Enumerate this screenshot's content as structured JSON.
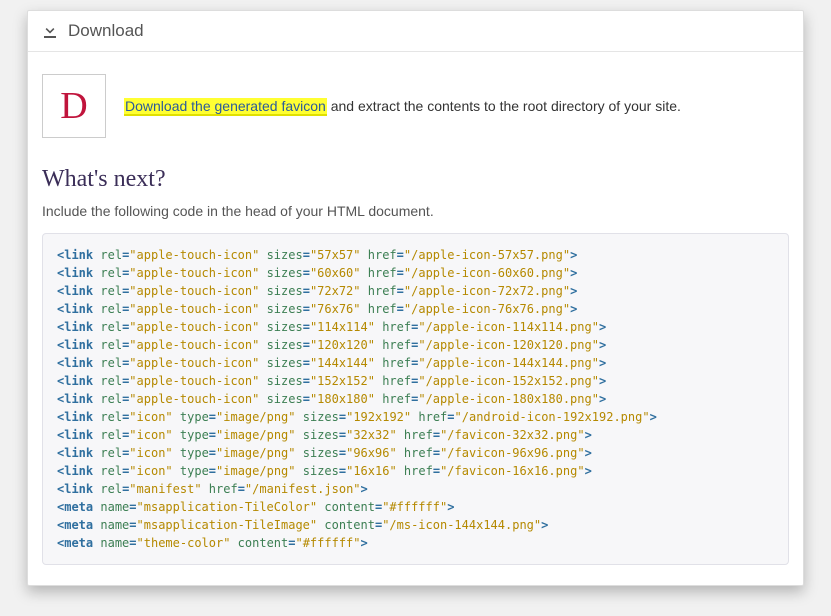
{
  "header": {
    "title": "Download"
  },
  "favicon_letter": "D",
  "instruction": {
    "link_text": "Download the generated favicon",
    "rest_text": " and extract the contents to the root directory of your site."
  },
  "next_heading": "What's next?",
  "next_sub": "Include the following code in the head of your HTML document.",
  "code_lines": [
    {
      "tag": "link",
      "attrs": [
        [
          "rel",
          "apple-touch-icon"
        ],
        [
          "sizes",
          "57x57"
        ],
        [
          "href",
          "/apple-icon-57x57.png"
        ]
      ]
    },
    {
      "tag": "link",
      "attrs": [
        [
          "rel",
          "apple-touch-icon"
        ],
        [
          "sizes",
          "60x60"
        ],
        [
          "href",
          "/apple-icon-60x60.png"
        ]
      ]
    },
    {
      "tag": "link",
      "attrs": [
        [
          "rel",
          "apple-touch-icon"
        ],
        [
          "sizes",
          "72x72"
        ],
        [
          "href",
          "/apple-icon-72x72.png"
        ]
      ]
    },
    {
      "tag": "link",
      "attrs": [
        [
          "rel",
          "apple-touch-icon"
        ],
        [
          "sizes",
          "76x76"
        ],
        [
          "href",
          "/apple-icon-76x76.png"
        ]
      ]
    },
    {
      "tag": "link",
      "attrs": [
        [
          "rel",
          "apple-touch-icon"
        ],
        [
          "sizes",
          "114x114"
        ],
        [
          "href",
          "/apple-icon-114x114.png"
        ]
      ]
    },
    {
      "tag": "link",
      "attrs": [
        [
          "rel",
          "apple-touch-icon"
        ],
        [
          "sizes",
          "120x120"
        ],
        [
          "href",
          "/apple-icon-120x120.png"
        ]
      ]
    },
    {
      "tag": "link",
      "attrs": [
        [
          "rel",
          "apple-touch-icon"
        ],
        [
          "sizes",
          "144x144"
        ],
        [
          "href",
          "/apple-icon-144x144.png"
        ]
      ]
    },
    {
      "tag": "link",
      "attrs": [
        [
          "rel",
          "apple-touch-icon"
        ],
        [
          "sizes",
          "152x152"
        ],
        [
          "href",
          "/apple-icon-152x152.png"
        ]
      ]
    },
    {
      "tag": "link",
      "attrs": [
        [
          "rel",
          "apple-touch-icon"
        ],
        [
          "sizes",
          "180x180"
        ],
        [
          "href",
          "/apple-icon-180x180.png"
        ]
      ]
    },
    {
      "tag": "link",
      "attrs": [
        [
          "rel",
          "icon"
        ],
        [
          "type",
          "image/png"
        ],
        [
          "sizes",
          "192x192"
        ],
        [
          "href",
          "/android-icon-192x192.png"
        ]
      ]
    },
    {
      "tag": "link",
      "attrs": [
        [
          "rel",
          "icon"
        ],
        [
          "type",
          "image/png"
        ],
        [
          "sizes",
          "32x32"
        ],
        [
          "href",
          "/favicon-32x32.png"
        ]
      ]
    },
    {
      "tag": "link",
      "attrs": [
        [
          "rel",
          "icon"
        ],
        [
          "type",
          "image/png"
        ],
        [
          "sizes",
          "96x96"
        ],
        [
          "href",
          "/favicon-96x96.png"
        ]
      ]
    },
    {
      "tag": "link",
      "attrs": [
        [
          "rel",
          "icon"
        ],
        [
          "type",
          "image/png"
        ],
        [
          "sizes",
          "16x16"
        ],
        [
          "href",
          "/favicon-16x16.png"
        ]
      ]
    },
    {
      "tag": "link",
      "attrs": [
        [
          "rel",
          "manifest"
        ],
        [
          "href",
          "/manifest.json"
        ]
      ]
    },
    {
      "tag": "meta",
      "attrs": [
        [
          "name",
          "msapplication-TileColor"
        ],
        [
          "content",
          "#ffffff"
        ]
      ]
    },
    {
      "tag": "meta",
      "attrs": [
        [
          "name",
          "msapplication-TileImage"
        ],
        [
          "content",
          "/ms-icon-144x144.png"
        ]
      ]
    },
    {
      "tag": "meta",
      "attrs": [
        [
          "name",
          "theme-color"
        ],
        [
          "content",
          "#ffffff"
        ]
      ]
    }
  ]
}
